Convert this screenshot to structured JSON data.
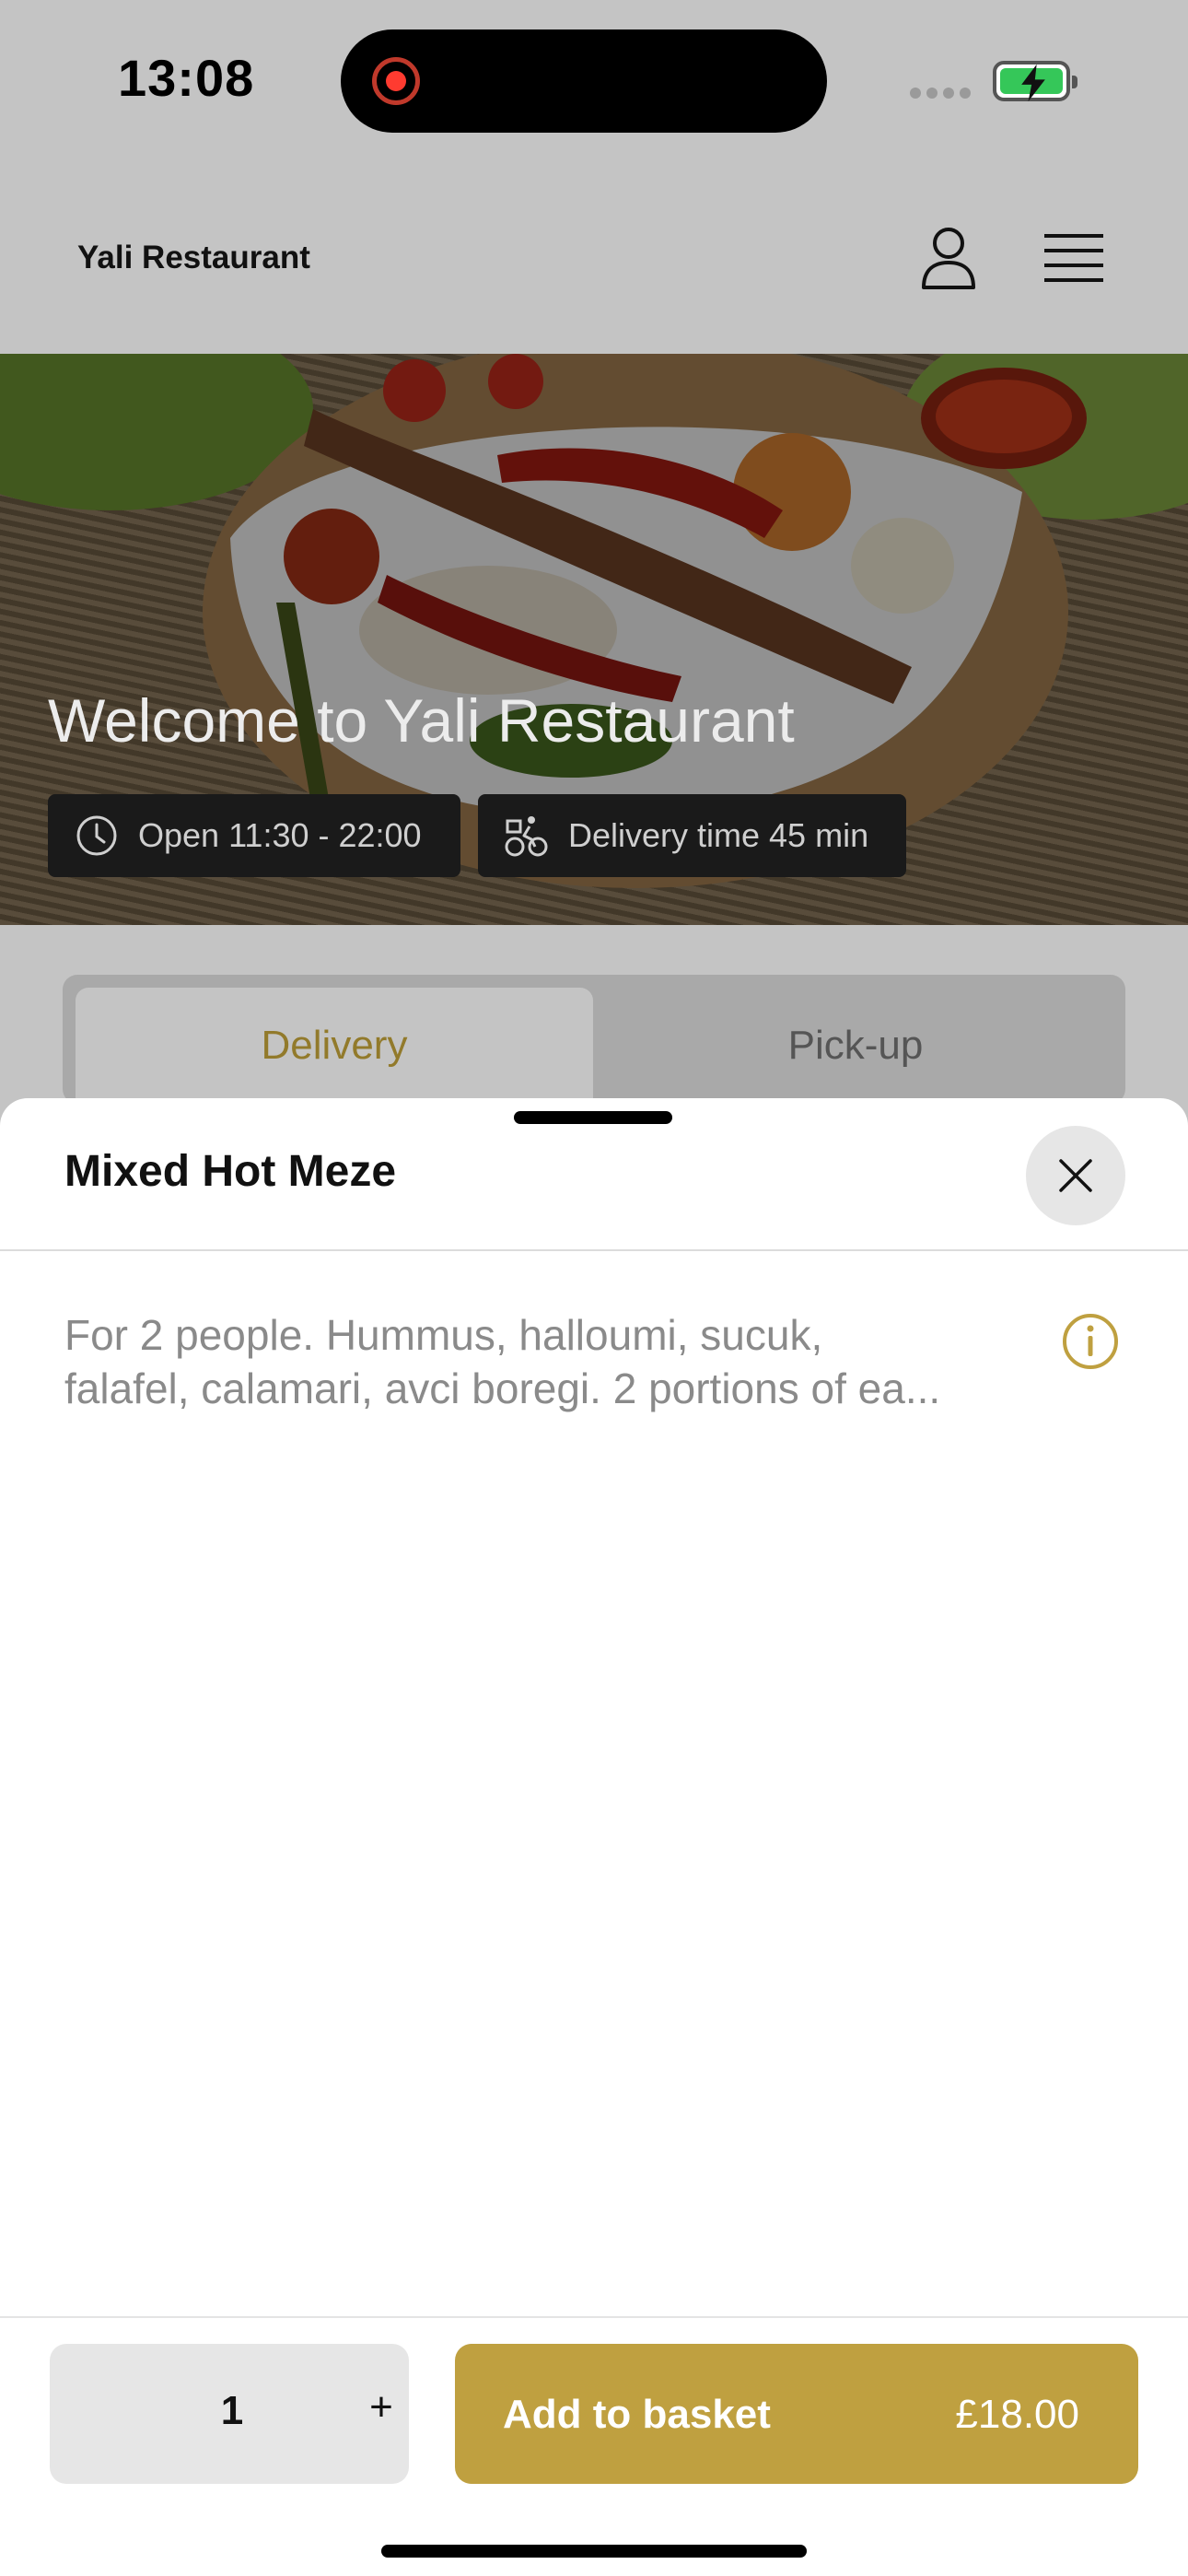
{
  "status_bar": {
    "time": "13:08",
    "battery_state": "charging"
  },
  "header": {
    "title": "Yali Restaurant"
  },
  "hero": {
    "title": "Welcome to Yali Restaurant",
    "hours_chip": "Open 11:30 - 22:00",
    "delivery_chip": "Delivery time 45 min"
  },
  "tabs": [
    {
      "label": "Delivery",
      "selected": true
    },
    {
      "label": "Pick-up",
      "selected": false
    }
  ],
  "sheet": {
    "title": "Mixed Hot Meze",
    "description_line1": "For 2 people. Hummus, halloumi, sucuk,",
    "description_line2": "falafel, calamari, avci boregi. 2 portions of ea..."
  },
  "footer": {
    "quantity": "1",
    "plus_label": "+",
    "add_label": "Add to basket",
    "price": "£18.00"
  },
  "colors": {
    "accent": "#bfa040",
    "overlay": "#c4c4c4",
    "tab_accent": "#927a2b"
  }
}
